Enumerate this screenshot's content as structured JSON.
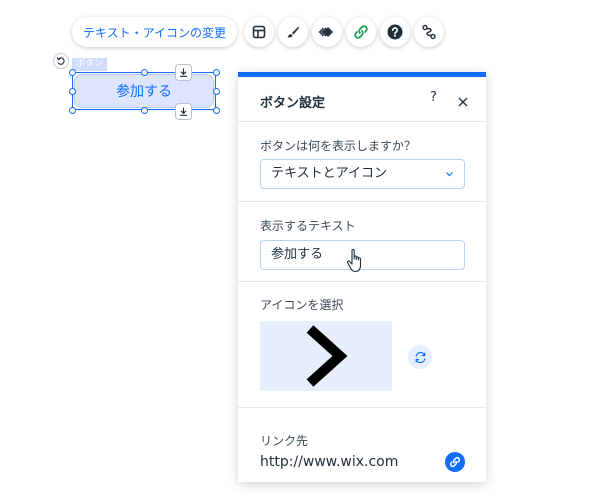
{
  "toolbar": {
    "change_text_icon_label": "テキスト・アイコンの変更",
    "buttons": [
      {
        "icon": "layout-icon"
      },
      {
        "icon": "design-brush-icon"
      },
      {
        "icon": "animation-icon"
      },
      {
        "icon": "link-icon"
      },
      {
        "icon": "help-icon"
      },
      {
        "icon": "connect-icon"
      }
    ]
  },
  "canvas": {
    "element_tag": "ボタン",
    "button_label": "参加する"
  },
  "panel": {
    "title": "ボタン設定",
    "help_label": "?",
    "display_section": {
      "label": "ボタンは何を表示しますか？",
      "selected": "テキストとアイコン"
    },
    "text_section": {
      "label": "表示するテキスト",
      "value": "参加する"
    },
    "icon_section": {
      "label": "アイコンを選択",
      "icon": "chevron-right-icon"
    },
    "link_section": {
      "label": "リンク先",
      "value": "http://www.wix.com"
    }
  },
  "colors": {
    "accent": "#116dff",
    "button_fill": "#dde5fe",
    "icon_preview_bg": "#e7eefe",
    "link_icon_green": "#1e9e5a"
  }
}
